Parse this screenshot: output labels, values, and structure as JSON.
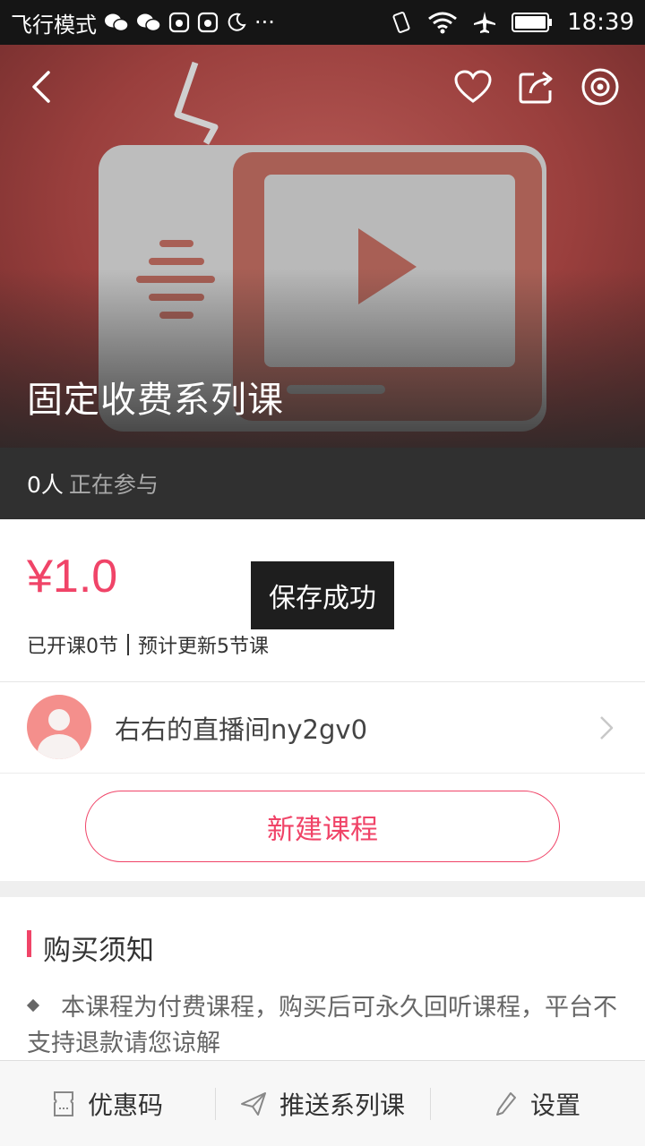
{
  "status_bar": {
    "carrier": "飞行模式",
    "time": "18:39",
    "more": "···"
  },
  "hero": {
    "title": "固定收费系列课",
    "back_icon": "chevron-left-icon",
    "favorite_icon": "heart-icon",
    "share_icon": "share-icon",
    "record_icon": "record-icon"
  },
  "participants": {
    "count": "0人",
    "label": "正在参与"
  },
  "price": {
    "value": "¥1.0",
    "opened": "已开课0节",
    "planned": "预计更新5节课"
  },
  "toast": {
    "text": "保存成功"
  },
  "host": {
    "name": "右右的直播间ny2gv0"
  },
  "actions": {
    "new_course": "新建课程"
  },
  "notice": {
    "title": "购买须知",
    "text": "本课程为付费课程，购买后可永久回听课程，平台不支持退款请您谅解"
  },
  "tabbar": {
    "items": [
      {
        "label": "优惠码",
        "icon": "coupon-icon"
      },
      {
        "label": "推送系列课",
        "icon": "send-icon"
      },
      {
        "label": "设置",
        "icon": "pencil-icon"
      }
    ]
  },
  "colors": {
    "accent": "#f04468",
    "hero_bg": "#9a3f3d",
    "participants_bg": "#303030"
  }
}
